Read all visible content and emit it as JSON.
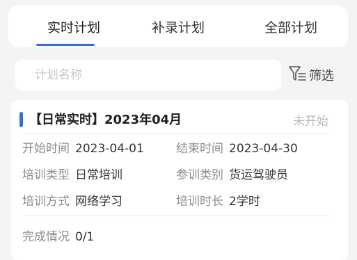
{
  "tabs": [
    {
      "label": "实时计划",
      "active": true
    },
    {
      "label": "补录计划",
      "active": false
    },
    {
      "label": "全部计划",
      "active": false
    }
  ],
  "search": {
    "placeholder": "计划名称",
    "value": ""
  },
  "filter": {
    "label": "筛选",
    "icon": "filter-icon"
  },
  "colors": {
    "accent": "#2f6fe0",
    "muted": "#8a8c90",
    "status": "#b8bbbf"
  },
  "plan": {
    "title": "【日常实时】2023年04月",
    "status": "未开始",
    "fields": {
      "start_time": {
        "label": "开始时间",
        "value": "2023-04-01"
      },
      "end_time": {
        "label": "结束时间",
        "value": "2023-04-30"
      },
      "training_type": {
        "label": "培训类型",
        "value": "日常培训"
      },
      "participant_type": {
        "label": "参训类别",
        "value": "货运驾驶员"
      },
      "training_method": {
        "label": "培训方式",
        "value": "网络学习"
      },
      "training_duration": {
        "label": "培训时长",
        "value": "2学时"
      },
      "completion": {
        "label": "完成情况",
        "value": "0/1"
      }
    }
  }
}
